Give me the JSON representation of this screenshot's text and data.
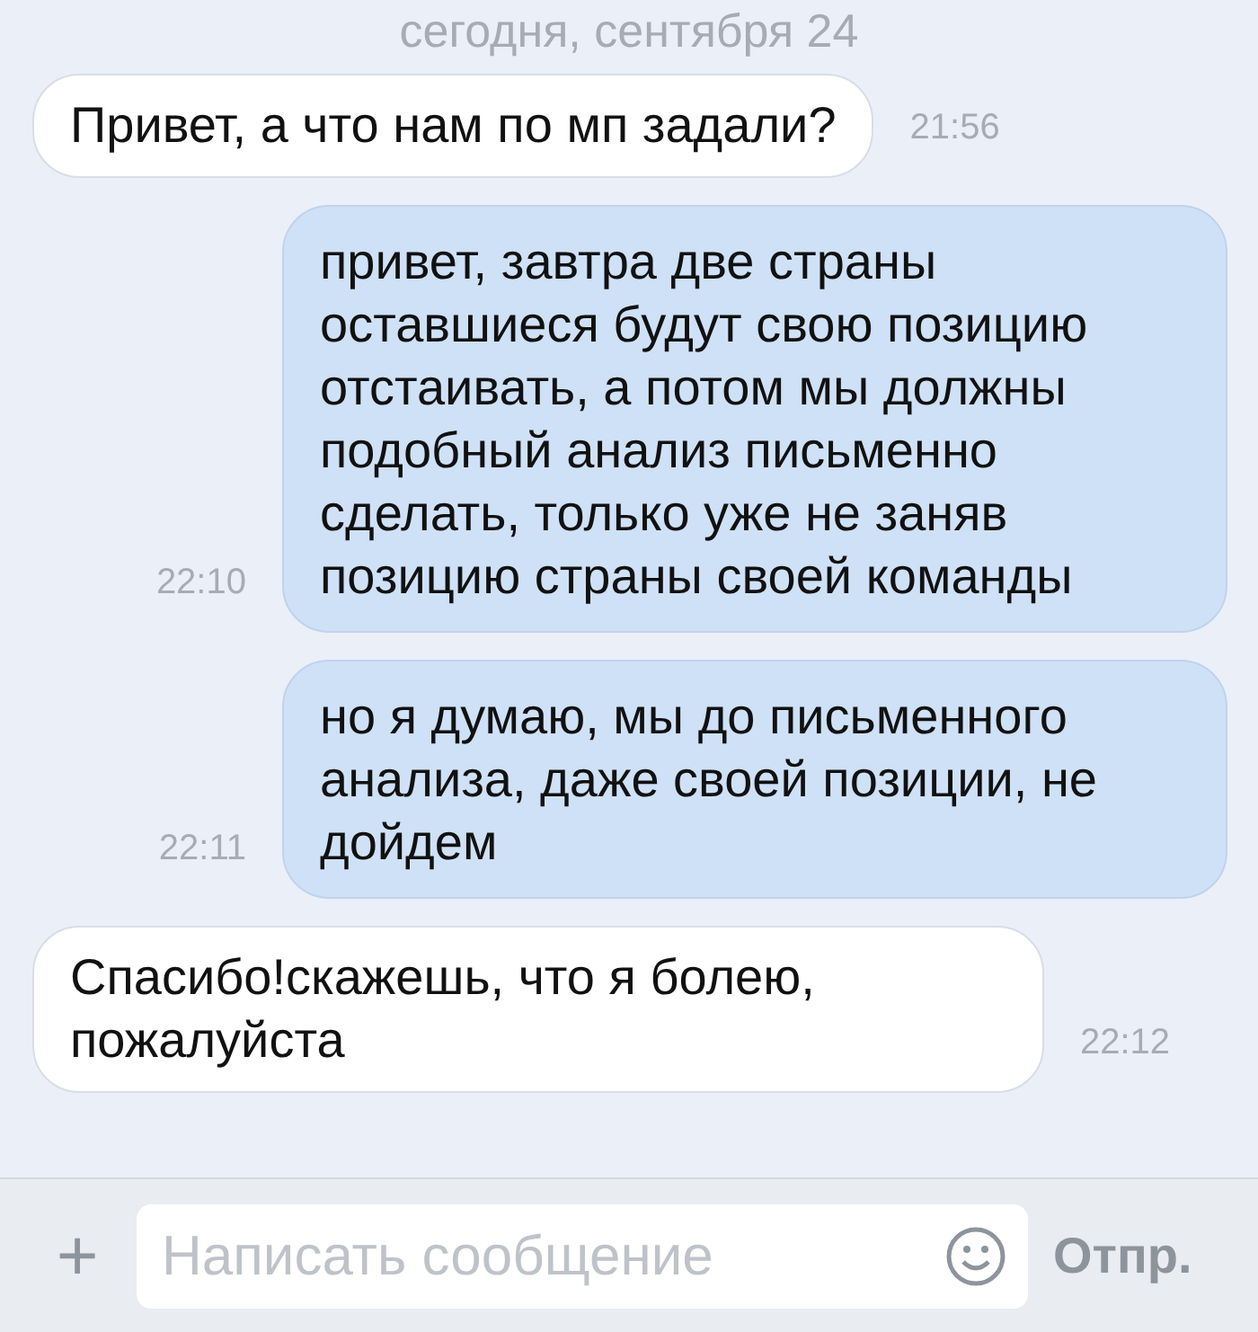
{
  "date_header": "сегодня, сентября 24",
  "messages": [
    {
      "kind": "incoming",
      "text": "Привет, а что нам по мп задали?",
      "time": "21:56"
    },
    {
      "kind": "outgoing",
      "text": "привет, завтра две страны оставшиеся будут свою позицию отстаивать, а потом мы должны подобный анализ письменно сделать, только уже не заняв позицию страны своей команды",
      "time": "22:10"
    },
    {
      "kind": "outgoing",
      "text": "но я думаю, мы до письменного анализа, даже своей позиции, не дойдем",
      "time": "22:11"
    },
    {
      "kind": "incoming",
      "text": "Спасибо!скажешь, что я болею, пожалуйста",
      "time": "22:12"
    }
  ],
  "composer": {
    "attach": "+",
    "placeholder": "Написать сообщение",
    "send": "Отпр."
  }
}
